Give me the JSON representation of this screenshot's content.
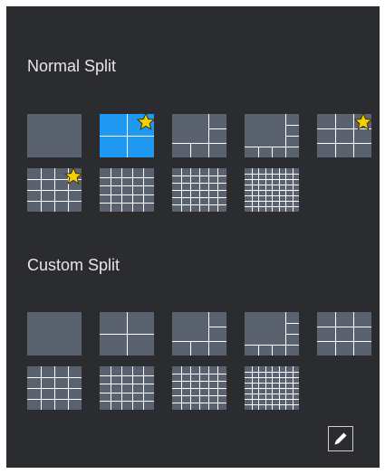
{
  "normal_split": {
    "title": "Normal Split",
    "layouts": [
      {
        "name": "single",
        "selected": false,
        "favorite": false
      },
      {
        "name": "quad",
        "selected": true,
        "favorite": true
      },
      {
        "name": "one-plus-five",
        "selected": false,
        "favorite": false
      },
      {
        "name": "one-plus-seven",
        "selected": false,
        "favorite": false
      },
      {
        "name": "grid-9",
        "selected": false,
        "favorite": true
      },
      {
        "name": "grid-16",
        "selected": false,
        "favorite": true
      },
      {
        "name": "grid-25",
        "selected": false,
        "favorite": false
      },
      {
        "name": "grid-36",
        "selected": false,
        "favorite": false
      },
      {
        "name": "grid-64",
        "selected": false,
        "favorite": false
      }
    ]
  },
  "custom_split": {
    "title": "Custom Split",
    "layouts": [
      {
        "name": "single"
      },
      {
        "name": "quad"
      },
      {
        "name": "one-plus-five"
      },
      {
        "name": "one-plus-seven"
      },
      {
        "name": "grid-9"
      },
      {
        "name": "grid-16"
      },
      {
        "name": "grid-25"
      },
      {
        "name": "grid-36"
      },
      {
        "name": "grid-64"
      }
    ]
  },
  "edit_button": {
    "icon": "pencil-icon"
  },
  "colors": {
    "panel_bg": "#2b2c30",
    "tile_bg": "#5a6270",
    "tile_line": "#ffffff",
    "selected_bg": "#1e98f0",
    "star": "#f5d000"
  }
}
